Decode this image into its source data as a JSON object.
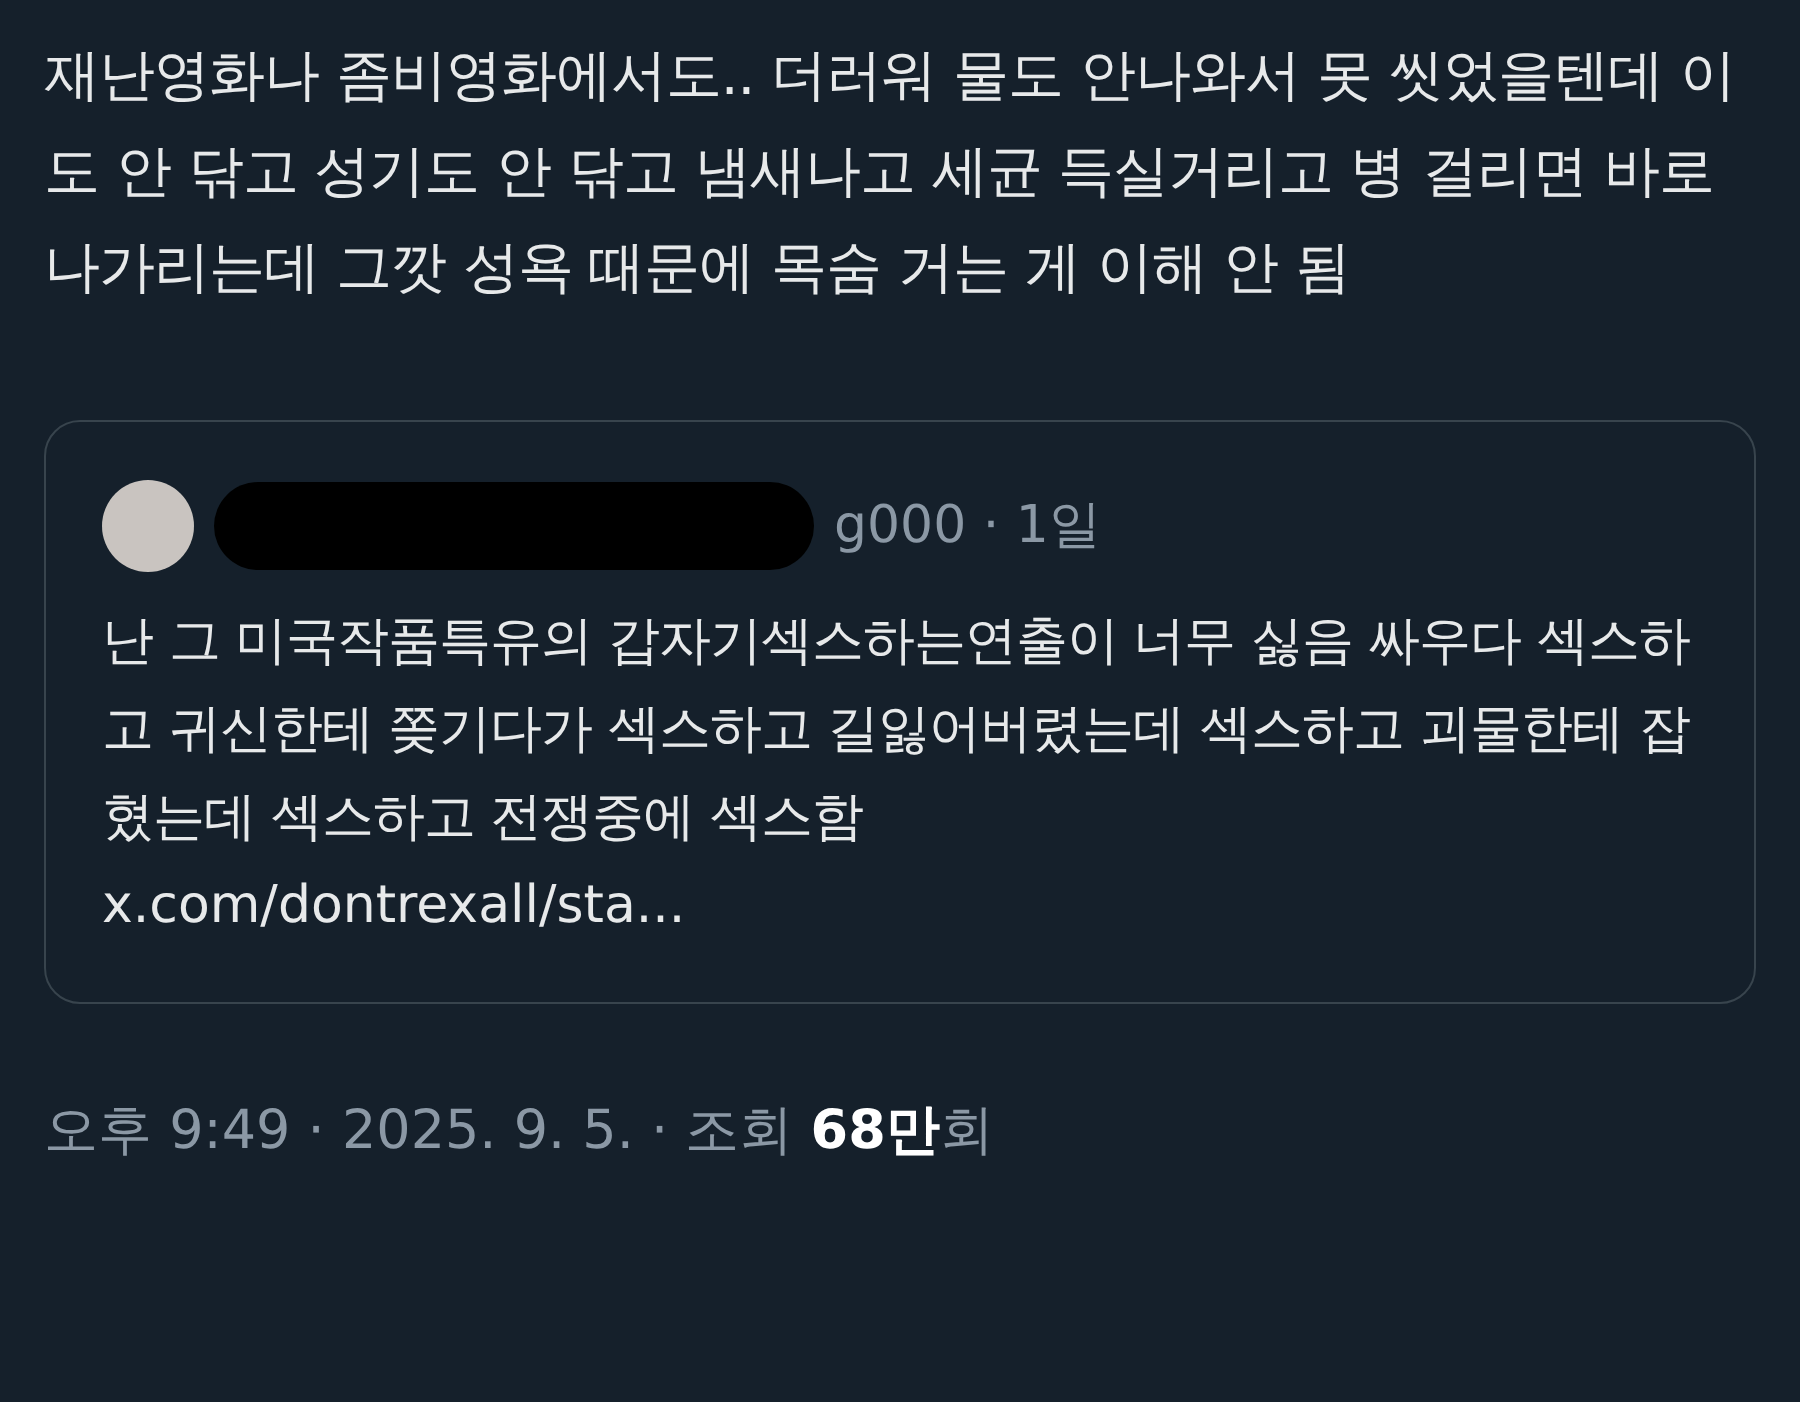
{
  "tweet": {
    "text": "재난영화나 좀비영화에서도.. 더러워 물도 안나와서 못 씻었을텐데 이도 안 닦고 성기도 안 닦고 냄새나고 세균 득실거리고 병 걸리면 바로 나가리는데 그깟 성욕 때문에 목숨 거는 게 이해 안 됨"
  },
  "quote": {
    "author_visible": "g000 · 1일",
    "text": "난 그 미국작품특유의 갑자기섹스하는연출이 너무 싫음 싸우다 섹스하고 귀신한테 쫒기다가 섹스하고 길잃어버렸는데 섹스하고 괴물한테 잡혔는데 섹스하고 전쟁중에 섹스함",
    "link": "x.com/dontrexall/sta..."
  },
  "meta": "오후 9:49 · 2025. 9. 5. · 조회 **68만**회"
}
